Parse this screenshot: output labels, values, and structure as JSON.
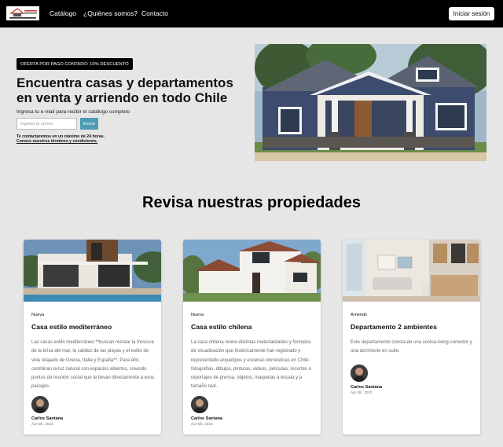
{
  "nav": {
    "logo_text": "CASA & TERRENO PROPIEDADES",
    "links": [
      "Catálogo",
      "¿Quiénes somos?",
      "Contacto"
    ],
    "login_label": "Iniciar sesión"
  },
  "hero": {
    "badge": "OFERTA POR PAGO CONTADO: 10% DESCUENTO",
    "title": "Encuentra casas y departamentos en venta y arriendo en todo Chile",
    "subtitle": "Ingresa tu e-mail para recibir el catálogo completo",
    "email_placeholder": "Ingresa tu correo",
    "send_label": "Enviar",
    "note_response": "Te contactaremos en un máximo de 24 horas.",
    "note_terms": "Conoce nuestros términos y condiciones."
  },
  "section": {
    "title": "Revisa nuestras propiedades"
  },
  "cards": [
    {
      "tag": "Nueva",
      "title": "Casa estilo mediterráneo",
      "description": "Las casas estilo mediterráneo **buscan recrear la frescura de la brisa del mar, la calidez de las playas y el estilo de vida relajado de Grecia, Italia y España**. Para ello, combinan la luz natural con espacios abiertos, creando puntos de reunión social que te llevan directamente a esos paisajes.",
      "author": "Carlos Santana",
      "date": "Apr 5th, 2023"
    },
    {
      "tag": "Nueva",
      "title": "Casa estilo chilena",
      "description": "La casa chilena reúne distintas materialidades y formatos de visualización que históricamente han registrado y representado arquetipos y escenas domésticas en Chile: fotografías, dibujos, pinturas, videos, películas, recortes o reportajes de prensa, objetos, maquetas a escala y a tamaño real.",
      "author": "Carlos Santana",
      "date": "Apr 5th, 2023"
    },
    {
      "tag": "Arriendo",
      "title": "Departamento 2 ambientes",
      "description": "Este departamento consta de una cocina-living-comedor y una dormitorio en suite.",
      "author": "Carlos Santana",
      "date": "Apr 5th, 2023"
    }
  ],
  "colors": {
    "nav_bg": "#000000",
    "page_bg": "#e6e6e6",
    "accent_button": "#4d9bb4"
  }
}
